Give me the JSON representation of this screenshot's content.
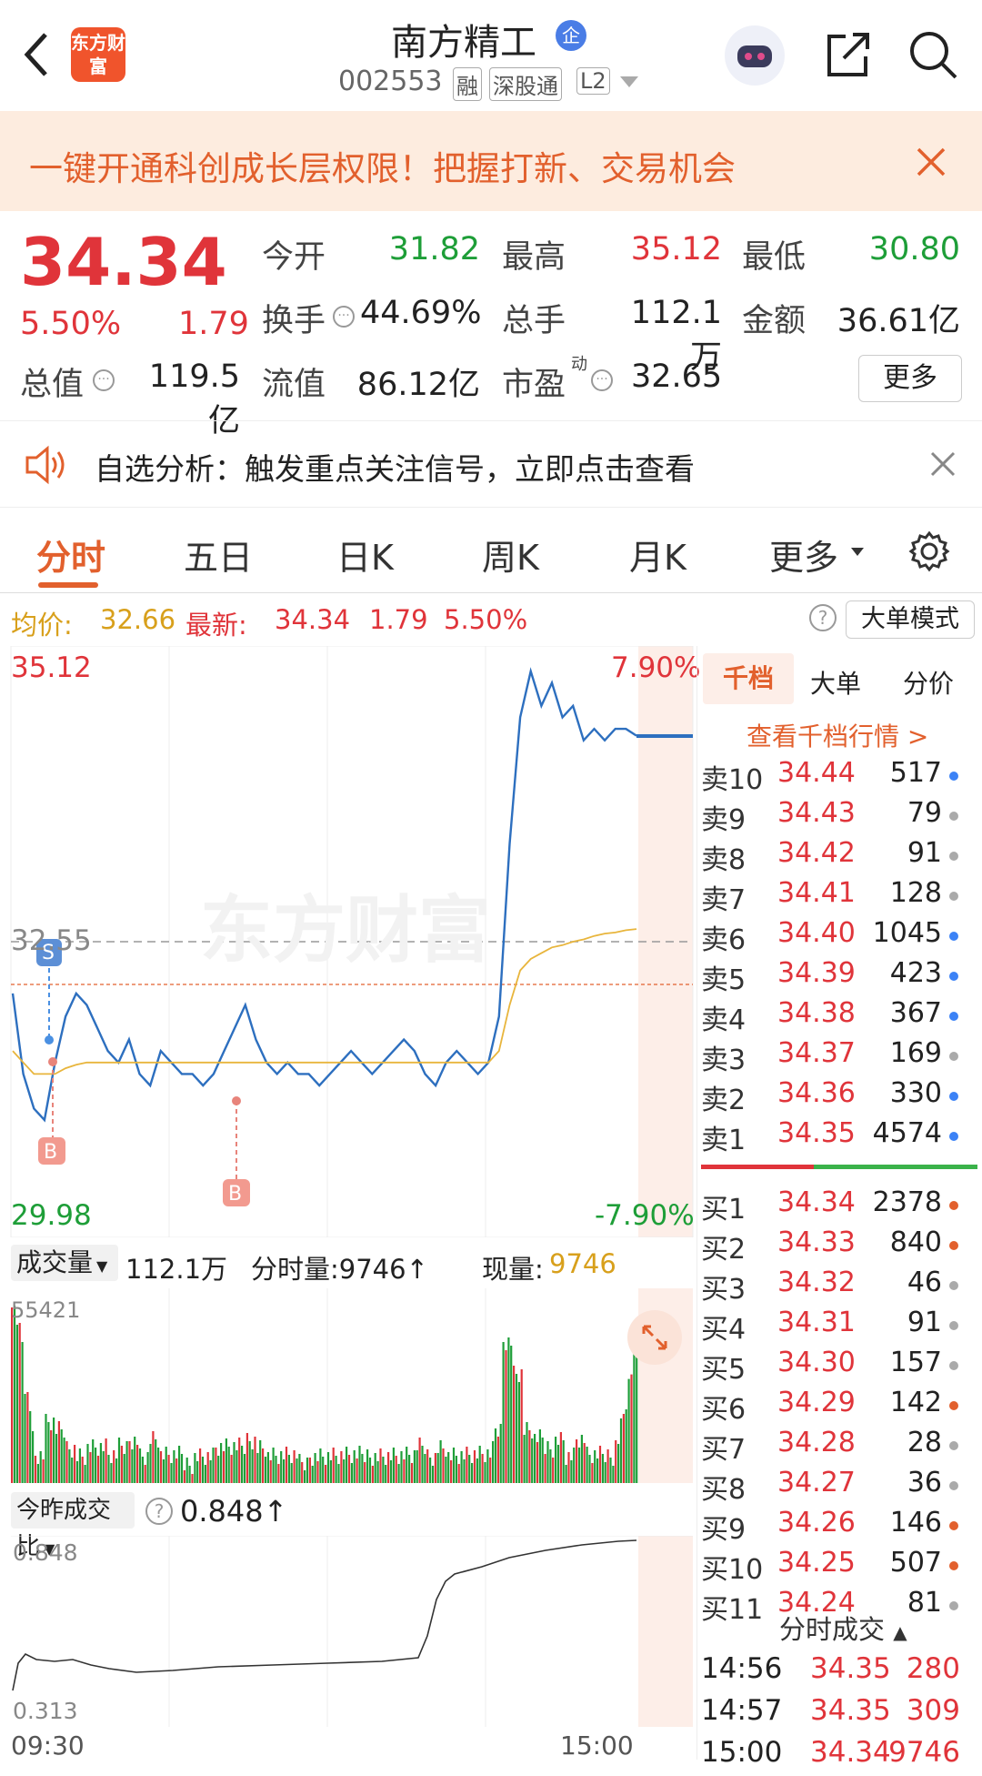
{
  "nav": {
    "stock_name": "南方精工",
    "badge": "企",
    "code": "002553",
    "tags": [
      "融",
      "深股通",
      "L2"
    ],
    "logo_text": "东方财富"
  },
  "banner": {
    "text": "一键开通科创成长层权限！把握打新、交易机会"
  },
  "quote": {
    "price": "34.34",
    "change_pct": "5.50%",
    "change": "1.79",
    "fields": [
      {
        "label": "今开",
        "value": "31.82",
        "color": "green"
      },
      {
        "label": "最高",
        "value": "35.12",
        "color": "red"
      },
      {
        "label": "最低",
        "value": "30.80",
        "color": "green"
      },
      {
        "label": "换手",
        "value": "44.69%",
        "color": "normal"
      },
      {
        "label": "总手",
        "value": "112.1万",
        "color": "normal"
      },
      {
        "label": "金额",
        "value": "36.61亿",
        "color": "normal"
      },
      {
        "label": "总值",
        "value": "119.5亿",
        "color": "normal"
      },
      {
        "label": "流值",
        "value": "86.12亿",
        "color": "normal"
      },
      {
        "label": "市盈",
        "value": "32.65",
        "color": "normal",
        "sup": "动"
      }
    ],
    "more_label": "更多"
  },
  "alert": {
    "text": "自选分析：触发重点关注信号，立即点击查看"
  },
  "tabs": [
    "分时",
    "五日",
    "日K",
    "周K",
    "月K",
    "更多"
  ],
  "active_tab": "分时",
  "infobar": {
    "avg_label": "均价:",
    "avg_value": "32.66",
    "latest_label": "最新:",
    "latest_value": "34.34",
    "change": "1.79",
    "change_pct": "5.50%",
    "big_order_mode": "大单模式"
  },
  "chart": {
    "y_top": "35.12",
    "y_mid": "32.55",
    "y_bottom": "29.98",
    "pct_top": "7.90%",
    "pct_bottom": "-7.90%",
    "watermark": "东方财富",
    "markers": [
      {
        "label": "S"
      },
      {
        "label": "B"
      },
      {
        "label": "B"
      }
    ]
  },
  "chart_data": {
    "type": "line",
    "title": "",
    "series": [
      {
        "values": [
          32.1,
          31.4,
          31.1,
          31.0,
          31.5,
          31.9,
          32.1,
          32.0,
          31.8,
          31.6,
          31.5,
          31.7,
          31.4,
          31.3,
          31.6,
          31.5,
          31.4,
          31.4,
          31.3,
          31.4,
          31.6,
          31.8,
          32.0,
          31.7,
          31.5,
          31.4,
          31.5,
          31.4,
          31.4,
          31.3,
          31.4,
          31.5,
          31.6,
          31.5,
          31.4,
          31.5,
          31.6,
          31.7,
          31.6,
          31.4,
          31.3,
          31.5,
          31.6,
          31.5,
          31.4,
          31.5,
          31.9,
          33.4,
          34.5,
          34.9,
          34.6,
          34.8,
          34.5,
          34.6,
          34.3,
          34.4,
          34.3,
          34.4,
          34.4,
          34.34
        ]
      },
      {
        "values": [
          31.6,
          31.5,
          31.4,
          31.4,
          31.4,
          31.45,
          31.48,
          31.5,
          31.5,
          31.5,
          31.5,
          31.5,
          31.5,
          31.5,
          31.5,
          31.5,
          31.5,
          31.5,
          31.5,
          31.5,
          31.5,
          31.5,
          31.5,
          31.5,
          31.5,
          31.5,
          31.5,
          31.5,
          31.5,
          31.5,
          31.5,
          31.5,
          31.5,
          31.5,
          31.5,
          31.5,
          31.5,
          31.5,
          31.5,
          31.5,
          31.5,
          31.5,
          31.5,
          31.5,
          31.5,
          31.5,
          31.6,
          32.0,
          32.3,
          32.4,
          32.45,
          32.5,
          32.52,
          32.55,
          32.57,
          32.6,
          32.62,
          32.63,
          32.65,
          32.66
        ]
      }
    ],
    "ylim": [
      29.98,
      35.12
    ]
  },
  "volume": {
    "label": "成交量",
    "total": "112.1万",
    "period_label": "分时量:9746↑",
    "current_label": "现量:",
    "current_value": "9746",
    "max_tick": "55421"
  },
  "ratio": {
    "label": "今昨成交比",
    "value": "0.848↑",
    "top": "0.848",
    "bottom": "0.313",
    "time_start": "09:30",
    "time_end": "15:00"
  },
  "orderbook": {
    "tabs": [
      "千档",
      "大单",
      "分价"
    ],
    "link": "查看千档行情 >",
    "sells": [
      {
        "label": "卖10",
        "price": "34.44",
        "qty": "517"
      },
      {
        "label": "卖9",
        "price": "34.43",
        "qty": "79"
      },
      {
        "label": "卖8",
        "price": "34.42",
        "qty": "91"
      },
      {
        "label": "卖7",
        "price": "34.41",
        "qty": "128"
      },
      {
        "label": "卖6",
        "price": "34.40",
        "qty": "1045"
      },
      {
        "label": "卖5",
        "price": "34.39",
        "qty": "423"
      },
      {
        "label": "卖4",
        "price": "34.38",
        "qty": "367"
      },
      {
        "label": "卖3",
        "price": "34.37",
        "qty": "169"
      },
      {
        "label": "卖2",
        "price": "34.36",
        "qty": "330"
      },
      {
        "label": "卖1",
        "price": "34.35",
        "qty": "4574"
      }
    ],
    "buys": [
      {
        "label": "买1",
        "price": "34.34",
        "qty": "2378"
      },
      {
        "label": "买2",
        "price": "34.33",
        "qty": "840"
      },
      {
        "label": "买3",
        "price": "34.32",
        "qty": "46"
      },
      {
        "label": "买4",
        "price": "34.31",
        "qty": "91"
      },
      {
        "label": "买5",
        "price": "34.30",
        "qty": "157"
      },
      {
        "label": "买6",
        "price": "34.29",
        "qty": "142"
      },
      {
        "label": "买7",
        "price": "34.28",
        "qty": "28"
      },
      {
        "label": "买8",
        "price": "34.27",
        "qty": "36"
      },
      {
        "label": "买9",
        "price": "34.26",
        "qty": "146"
      },
      {
        "label": "买10",
        "price": "34.25",
        "qty": "507"
      },
      {
        "label": "买11",
        "price": "34.24",
        "qty": "81"
      }
    ],
    "trades_title": "分时成交",
    "trades": [
      {
        "time": "14:56",
        "price": "34.35",
        "qty": "280"
      },
      {
        "time": "14:57",
        "price": "34.35",
        "qty": "309"
      },
      {
        "time": "15:00",
        "price": "34.34",
        "qty": "9746"
      }
    ]
  }
}
